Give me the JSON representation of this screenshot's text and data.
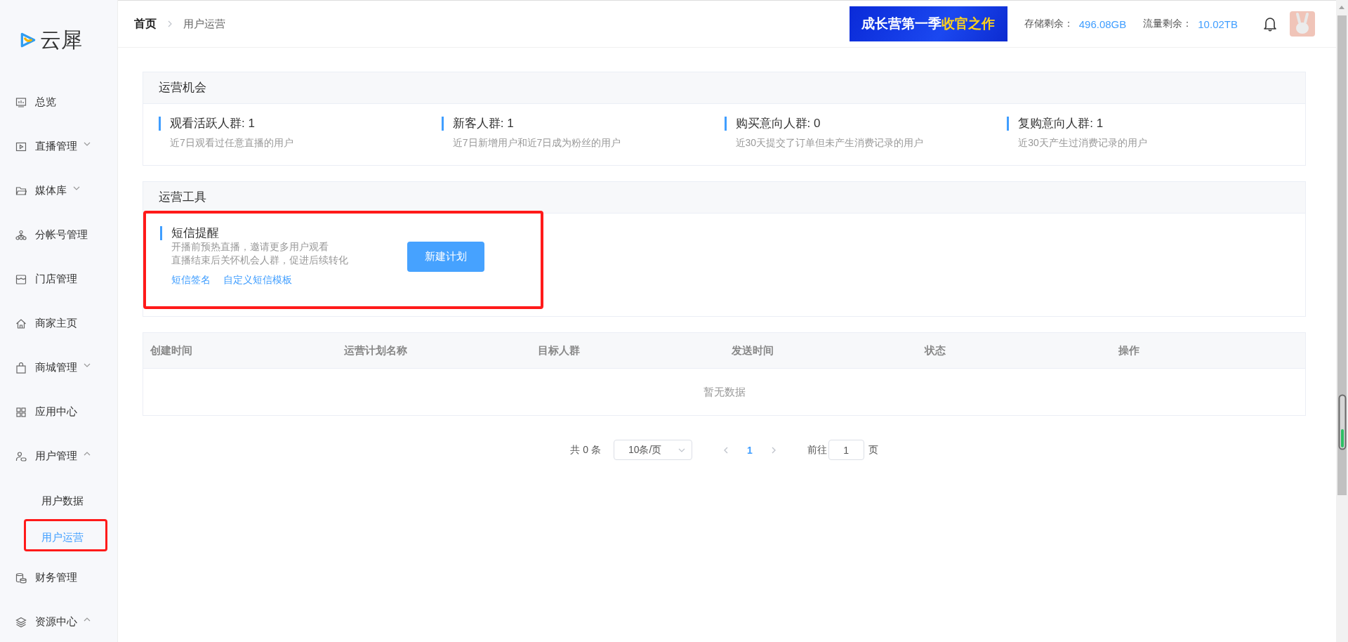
{
  "sidebar": {
    "logo": "云犀",
    "items": [
      {
        "label": "总览"
      },
      {
        "label": "直播管理",
        "expanded": false
      },
      {
        "label": "媒体库",
        "expanded": false
      },
      {
        "label": "分帐号管理"
      },
      {
        "label": "门店管理"
      },
      {
        "label": "商家主页"
      },
      {
        "label": "商城管理",
        "expanded": false
      },
      {
        "label": "应用中心"
      },
      {
        "label": "用户管理",
        "expanded": true,
        "children": [
          {
            "label": "用户数据",
            "selected": false,
            "highlighted": false
          },
          {
            "label": "用户运营",
            "selected": true,
            "highlighted": true
          }
        ]
      },
      {
        "label": "财务管理"
      },
      {
        "label": "资源中心",
        "expanded": true
      }
    ]
  },
  "breadcrumb": [
    {
      "label": "首页",
      "current": false
    },
    {
      "label": "用户运营",
      "current": true
    }
  ],
  "header": {
    "banner": {
      "text": "成长营第一季",
      "highlight": "收官之作"
    },
    "storage": {
      "label": "存储剩余：",
      "value": "496.08GB"
    },
    "traffic": {
      "label": "流量剩余：",
      "value": "10.02TB"
    }
  },
  "opportunities": {
    "title": "运营机会",
    "items": [
      {
        "title": "观看活跃人群: 1",
        "description": "近7日观看过任意直播的用户"
      },
      {
        "title": "新客人群: 1",
        "description": "近7日新增用户和近7日成为粉丝的用户"
      },
      {
        "title": "购买意向人群: 0",
        "description": "近30天提交了订单但未产生消费记录的用户"
      },
      {
        "title": "复购意向人群: 1",
        "description": "近30天产生过消费记录的用户"
      }
    ]
  },
  "tools": {
    "title": "运营工具",
    "items": [
      {
        "title": "短信提醒",
        "description": [
          "开播前预热直播，邀请更多用户观看",
          "直播结束后关怀机会人群，促进后续转化"
        ],
        "links": [
          "短信签名",
          "自定义短信模板"
        ],
        "button": "新建计划",
        "highlighted": true
      }
    ]
  },
  "table": {
    "columns": [
      "创建时间",
      "运营计划名称",
      "目标人群",
      "发送时间",
      "状态",
      "操作"
    ],
    "empty_text": "暂无数据"
  },
  "pagination": {
    "total": "共 0 条",
    "page_size": "10条/页",
    "pages": [
      {
        "label": "1",
        "selected": true
      }
    ],
    "goto_label": "前往",
    "goto_value": "1",
    "goto_suffix": "页"
  }
}
